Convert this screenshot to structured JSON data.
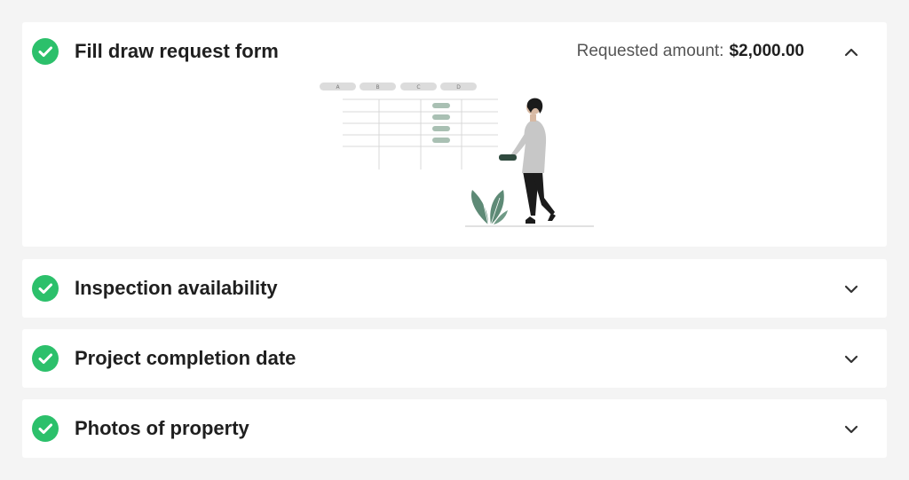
{
  "steps": [
    {
      "title": "Fill draw request form",
      "expanded": true,
      "status": "complete",
      "requested_amount_label": "Requested amount:",
      "requested_amount_value": "$2,000.00",
      "illustration": {
        "column_headers": [
          "A",
          "B",
          "C",
          "D"
        ]
      }
    },
    {
      "title": "Inspection availability",
      "expanded": false,
      "status": "complete"
    },
    {
      "title": "Project completion date",
      "expanded": false,
      "status": "complete"
    },
    {
      "title": "Photos of property",
      "expanded": false,
      "status": "complete"
    }
  ],
  "icons": {
    "status": "check-circle-icon",
    "expanded": "chevron-up-icon",
    "collapsed": "chevron-down-icon"
  },
  "colors": {
    "complete_green": "#2cc06b",
    "illustration_accent": "#5e8a76",
    "page_background": "#f4f4f4",
    "card_background": "#ffffff"
  }
}
